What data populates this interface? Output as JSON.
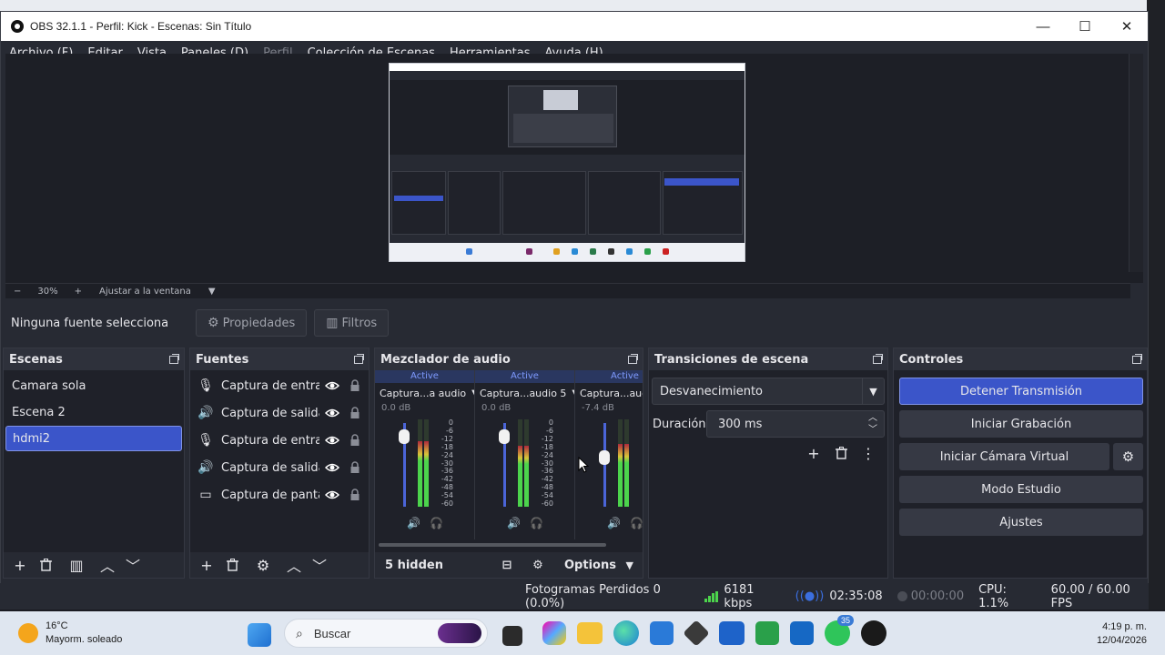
{
  "window": {
    "title": "OBS 32.1.1 - Perfil: Kick - Escenas: Sin Título",
    "minimize": "—",
    "maximize": "☐",
    "close": "✕"
  },
  "menu": [
    "Archivo (F)",
    "Editar",
    "Vista",
    "Paneles (D)",
    "Perfil",
    "Colección de Escenas",
    "Herramientas",
    "Ayuda (H)"
  ],
  "zoom": {
    "zoom_out": "−",
    "level": "30%",
    "zoom_in": "+",
    "fit": "Ajustar a la ventana"
  },
  "context": {
    "no_source": "Ninguna fuente selecciona",
    "properties": "Propiedades",
    "filters": "Filtros"
  },
  "scenes": {
    "title": "Escenas",
    "items": [
      "Camara sola",
      "Escena 2",
      "hdmi2"
    ],
    "selected": "hdmi2"
  },
  "sources": {
    "title": "Fuentes",
    "items": [
      {
        "name": "Captura de entrada de audio",
        "icon": "microphone-icon"
      },
      {
        "name": "Captura de salida de audio",
        "icon": "speaker-icon"
      },
      {
        "name": "Captura de entrada de audio",
        "icon": "microphone-icon"
      },
      {
        "name": "Captura de salida de audio",
        "icon": "speaker-icon"
      },
      {
        "name": "Captura de pantalla",
        "icon": "monitor-icon"
      }
    ]
  },
  "mixer": {
    "title": "Mezclador de audio",
    "strips": [
      {
        "status": "Active",
        "name": "Captura...a audio",
        "db": "0.0 dB",
        "level": 0.75,
        "fader": 0.9
      },
      {
        "status": "Active",
        "name": "Captura...audio 5",
        "db": "0.0 dB",
        "level": 0.7,
        "fader": 0.9
      },
      {
        "status": "Active",
        "name": "Captura...audio",
        "db": "-7.4 dB",
        "level": 0.72,
        "fader": 0.65
      }
    ],
    "scale": [
      "0",
      "-6",
      "-12",
      "-18",
      "-24",
      "-30",
      "-36",
      "-42",
      "-48",
      "-54",
      "-60"
    ],
    "hidden": "5 hidden",
    "options": "Options"
  },
  "transitions": {
    "title": "Transiciones de escena",
    "selected": "Desvanecimiento",
    "duration_label": "Duración",
    "duration": "300 ms"
  },
  "controls": {
    "title": "Controles",
    "stop_stream": "Detener Transmisión",
    "start_recording": "Iniciar Grabación",
    "virtual_camera": "Iniciar Cámara Virtual",
    "studio_mode": "Modo Estudio",
    "settings": "Ajustes"
  },
  "status": {
    "dropped": "Fotogramas Perdidos 0 (0.0%)",
    "bitrate": "6181 kbps",
    "stream_time": "02:35:08",
    "rec_time": "00:00:00",
    "cpu": "CPU: 1.1%",
    "fps": "60.00 / 60.00 FPS"
  },
  "taskbar": {
    "temp": "16°C",
    "weather": "Mayorm. soleado",
    "search_placeholder": "Buscar",
    "whatsapp_badge": "35",
    "time": "4:19 p. m.",
    "date": "12/04/2026"
  },
  "colors": {
    "accent": "#3b55c9",
    "panel": "#1f2129",
    "meter_green": "#4cd44c"
  }
}
